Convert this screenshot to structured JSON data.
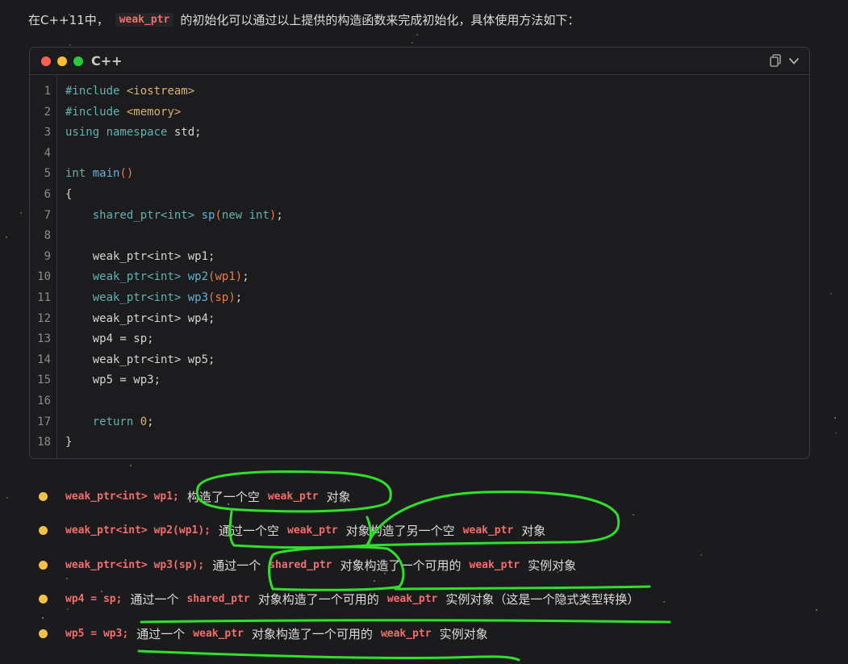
{
  "intro": {
    "prefix": "在C++11中，",
    "code": "weak_ptr",
    "suffix": "的初始化可以通过以上提供的构造函数来完成初始化，具体使用方法如下："
  },
  "code_block": {
    "language": "C++",
    "copy_icon": "copy-icon",
    "expand_icon": "chevron-down-icon",
    "lines": [
      {
        "n": "1",
        "text": "#include <iostream>"
      },
      {
        "n": "2",
        "text": "#include <memory>"
      },
      {
        "n": "3",
        "text": "using namespace std;"
      },
      {
        "n": "4",
        "text": ""
      },
      {
        "n": "5",
        "text": "int main()"
      },
      {
        "n": "6",
        "text": "{"
      },
      {
        "n": "7",
        "text": "    shared_ptr<int> sp(new int);"
      },
      {
        "n": "8",
        "text": ""
      },
      {
        "n": "9",
        "text": "    weak_ptr<int> wp1;"
      },
      {
        "n": "10",
        "text": "    weak_ptr<int> wp2(wp1);"
      },
      {
        "n": "11",
        "text": "    weak_ptr<int> wp3(sp);"
      },
      {
        "n": "12",
        "text": "    weak_ptr<int> wp4;"
      },
      {
        "n": "13",
        "text": "    wp4 = sp;"
      },
      {
        "n": "14",
        "text": "    weak_ptr<int> wp5;"
      },
      {
        "n": "15",
        "text": "    wp5 = wp3;"
      },
      {
        "n": "16",
        "text": ""
      },
      {
        "n": "17",
        "text": "    return 0;"
      },
      {
        "n": "18",
        "text": "}"
      }
    ]
  },
  "bullets": [
    {
      "code": "weak_ptr<int> wp1;",
      "t1": "构造了一个空",
      "c2": "weak_ptr",
      "t2": "对象"
    },
    {
      "code": "weak_ptr<int> wp2(wp1);",
      "t1": "通过一个空",
      "c2": "weak_ptr",
      "t2": "对象构造了另一个空",
      "c3": "weak_ptr",
      "t3": "对象"
    },
    {
      "code": "weak_ptr<int> wp3(sp);",
      "t1": "通过一个",
      "c2": "shared_ptr",
      "t2": "对象构造了一个可用的",
      "c3": "weak_ptr",
      "t3": "实例对象"
    },
    {
      "code": "wp4 = sp;",
      "t1": "通过一个",
      "c2": "shared_ptr",
      "t2": "对象构造了一个可用的",
      "c3": "weak_ptr",
      "t3": "实例对象（这是一个隐式类型转换）"
    },
    {
      "code": "wp5 = wp3;",
      "t1": "通过一个",
      "c2": "weak_ptr",
      "t2": "对象构造了一个可用的",
      "c3": "weak_ptr",
      "t3": "实例对象"
    }
  ],
  "colors": {
    "background": "#1b1b1d",
    "inline_code": "#f26d6d",
    "bullet_dot": "#f7c04a",
    "annotation": "#2fe02a"
  }
}
